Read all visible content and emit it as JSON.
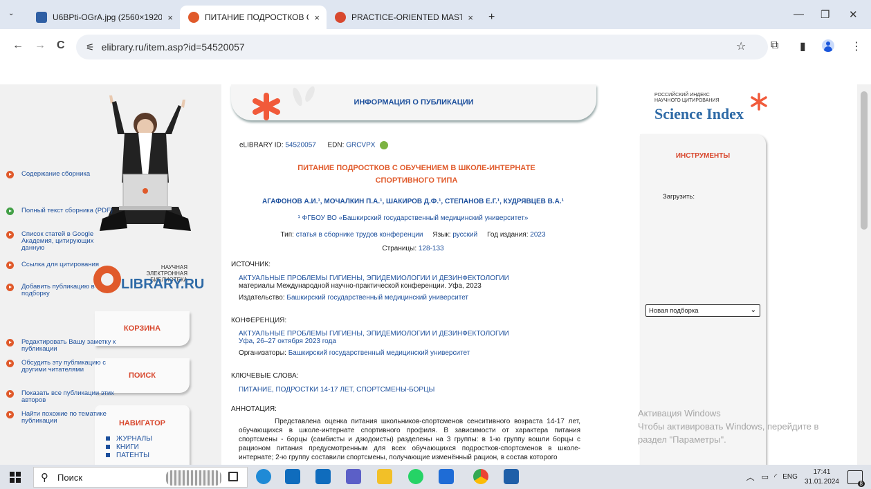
{
  "tabs": [
    {
      "title": "U6BPti-OGrA.jpg (2560×1920)",
      "close": "×",
      "color": "#2f5fa4"
    },
    {
      "title": "ПИТАНИЕ ПОДРОСТКОВ С ОБ",
      "close": "×",
      "color": "#e05a2b"
    },
    {
      "title": "PRACTICE-ORIENTED MASTERI",
      "close": "×",
      "color": "#d8482e"
    }
  ],
  "new_tab": "+",
  "window": {
    "minimize": "—",
    "restore": "❐",
    "close": "✕"
  },
  "url": "elibrary.ru/item.asp?id=54520057",
  "nav": {
    "back": "←",
    "forward": "→",
    "reload": "C",
    "site_info": "⚟"
  },
  "toolbar_icons": {
    "star": "☆",
    "ext": "⧉",
    "sidebar": "▮",
    "menu": "⋮"
  },
  "left": {
    "logo_line1": "НАУЧНАЯ ЭЛЕКТРОННАЯ",
    "logo_line2": "БИБЛИОТЕКА",
    "logo_name": "LIBRARY.RU",
    "cart": "КОРЗИНА",
    "search": "ПОИСК",
    "navigator": "НАВИГАТОР",
    "nav_items": [
      "ЖУРНАЛЫ",
      "КНИГИ",
      "ПАТЕНТЫ"
    ]
  },
  "header": "ИНФОРМАЦИЯ О ПУБЛИКАЦИИ",
  "pub": {
    "id_label": "eLIBRARY ID:",
    "id": "54520057",
    "edn_label": "EDN:",
    "edn": "GRCVPX",
    "title_l1": "ПИТАНИЕ ПОДРОСТКОВ С ОБУЧЕНИЕМ В ШКОЛЕ-ИНТЕРНАТЕ",
    "title_l2": "СПОРТИВНОГО ТИПА",
    "authors": "АГАФОНОВ А.И.¹, МОЧАЛКИН П.А.¹, ШАКИРОВ Д.Ф.¹, СТЕПАНОВ Е.Г.¹, КУДРЯВЦЕВ В.А.¹",
    "affiliation": "¹ ФГБОУ ВО «Башкирский государственный медицинский университет»",
    "type_label": "Тип:",
    "type": "статья в сборнике трудов конференции",
    "lang_label": "Язык:",
    "lang": "русский",
    "year_label": "Год издания:",
    "year": "2023",
    "pages_label": "Страницы:",
    "pages": "128-133"
  },
  "source": {
    "heading": "ИСТОЧНИК:",
    "name": "АКТУАЛЬНЫЕ ПРОБЛЕМЫ ГИГИЕНЫ, ЭПИДЕМИОЛОГИИ И ДЕЗИНФЕКТОЛОГИИ",
    "desc": "материалы Международной научно-практической конференции. Уфа, 2023",
    "pub_label": "Издательство:",
    "publisher": "Башкирский государственный медицинский университет"
  },
  "conference": {
    "heading": "КОНФЕРЕНЦИЯ:",
    "name": "АКТУАЛЬНЫЕ ПРОБЛЕМЫ ГИГИЕНЫ, ЭПИДЕМИОЛОГИИ И ДЕЗИНФЕКТОЛОГИИ",
    "date": "Уфа, 26–27 октября 2023 года",
    "org_label": "Организаторы:",
    "org": "Башкирский государственный медицинский университет"
  },
  "keywords": {
    "heading": "КЛЮЧЕВЫЕ СЛОВА:",
    "list": "ПИТАНИЕ, ПОДРОСТКИ 14-17 ЛЕТ, СПОРТСМЕНЫ-БОРЦЫ"
  },
  "abstract": {
    "heading": "АННОТАЦИЯ:",
    "text": "Представлена оценка питания школьников-спортсменов сенситивного возраста 14-17 лет, обучающихся в школе-интернате спортивного профиля. В зависимости от характера питания спортсмены - борцы (самбисты и дзюдоисты) разделены на 3 группы: в 1-ю группу вошли борцы с рационом питания предусмотренным для всех обучающихся подростков-спортсменов в школе-интернате; 2-ю группу составили спортсмены, получающие изменённый рацион, в состав которого"
  },
  "science_index": {
    "line1": "РОССИЙСКИЙ ИНДЕКС",
    "line2": "НАУЧНОГО ЦИТИРОВАНИЯ",
    "name": "Science Index"
  },
  "tools": {
    "heading": "ИНСТРУМЕНТЫ",
    "contents": "Содержание сборника",
    "download_label": "Загрузить:",
    "fulltext": "Полный текст сборника (PDF)",
    "scholar": "Список статей в Google Академия, цитирующих данную",
    "cite": "Ссылка для цитирования",
    "add": "Добавить публикацию в подборку",
    "select": "Новая подборка",
    "edit_note": "Редактировать Вашу заметку к публикации",
    "discuss": "Обсудить эту публикацию с другими читателями",
    "show_all": "Показать все публикации этих авторов",
    "similar": "Найти похожие по тематике публикации"
  },
  "watermark": {
    "line1": "Активация Windows",
    "line2": "Чтобы активировать Windows, перейдите в",
    "line3": "раздел \"Параметры\"."
  },
  "taskbar": {
    "search": "Поиск",
    "lang": "ENG",
    "time": "17:41",
    "date": "31.01.2024",
    "notif": "8"
  }
}
